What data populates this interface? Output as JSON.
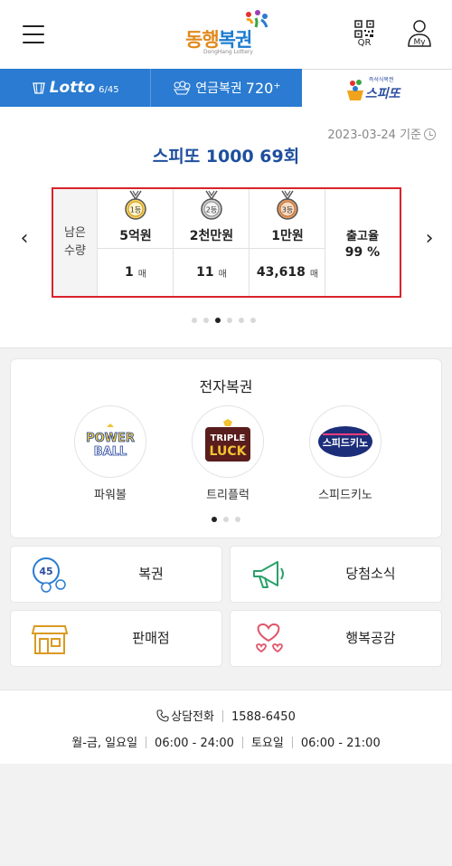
{
  "header": {
    "logo_text_1": "동행",
    "logo_text_2": "복권",
    "logo_sub": "DongHang Lottery",
    "qr_label": "QR",
    "my_label": "My"
  },
  "tabs": [
    {
      "label": "Lotto",
      "sub": "6/45"
    },
    {
      "label": "연금복권",
      "sub": "720⁺"
    },
    {
      "label": "스피또",
      "sub": "즉석식복권"
    }
  ],
  "speetto": {
    "date": "2023-03-24 기준",
    "title": "스피또 1000 69회",
    "remain_label_1": "남은",
    "remain_label_2": "수량",
    "prizes": [
      {
        "rank": "1등",
        "amount": "5억원",
        "count": "1",
        "unit": "매",
        "medal_color": "#e3a630"
      },
      {
        "rank": "2등",
        "amount": "2천만원",
        "count": "11",
        "unit": "매",
        "medal_color": "#9a9a9a"
      },
      {
        "rank": "3등",
        "amount": "1만원",
        "count": "43,618",
        "unit": "매",
        "medal_color": "#d0884a"
      }
    ],
    "rate_label": "출고율",
    "rate_value": "99 %",
    "active_slide": 3
  },
  "elottery": {
    "title": "전자복권",
    "games": [
      {
        "label": "파워볼",
        "logo_line1": "POWER",
        "logo_line2": "BALL"
      },
      {
        "label": "트리플럭",
        "logo_line1": "TRIPLE",
        "logo_line2": "LUCK"
      },
      {
        "label": "스피드키노",
        "logo_line1": "스피드키노",
        "logo_line2": ""
      }
    ]
  },
  "quick_links": [
    {
      "label": "복권",
      "icon": "lottery-balls-icon"
    },
    {
      "label": "당첨소식",
      "icon": "megaphone-icon"
    },
    {
      "label": "판매점",
      "icon": "store-icon"
    },
    {
      "label": "행복공감",
      "icon": "hearts-icon"
    }
  ],
  "footer": {
    "phone_label": "상담전화",
    "phone_number": "1588-6450",
    "weekday_label": "월-금, 일요일",
    "weekday_hours": "06:00 - 24:00",
    "sat_label": "토요일",
    "sat_hours": "06:00 - 21:00"
  },
  "colors": {
    "brand_blue": "#2a7bd1",
    "title_blue": "#1e4f9e",
    "highlight_red": "#d9232b"
  }
}
